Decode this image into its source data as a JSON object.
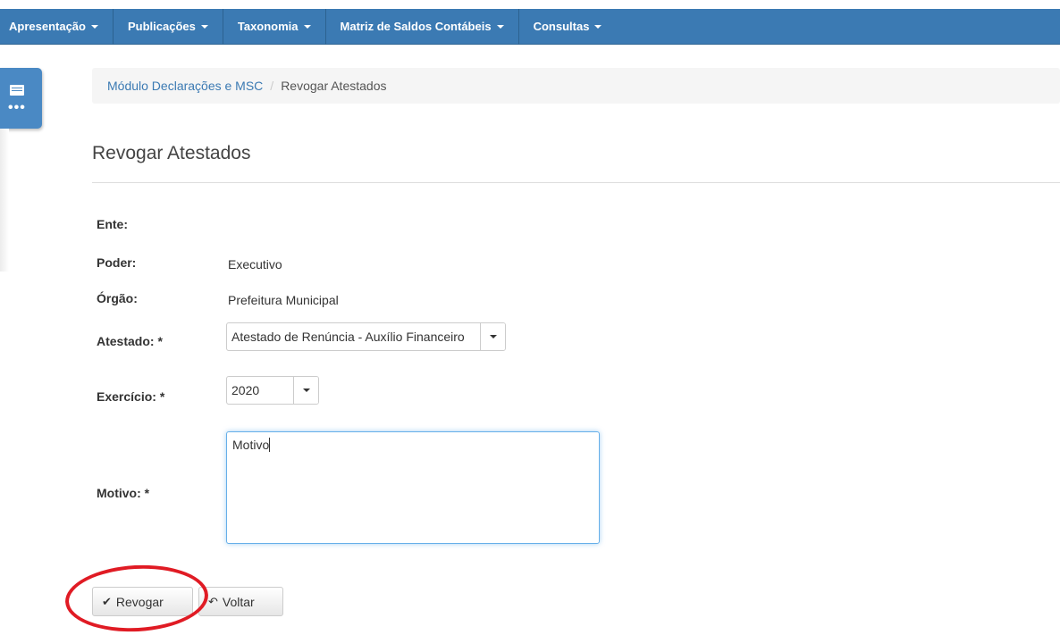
{
  "nav": {
    "items": [
      {
        "label": "Apresentação"
      },
      {
        "label": "Publicações"
      },
      {
        "label": "Taxonomia"
      },
      {
        "label": "Matriz de Saldos Contábeis"
      },
      {
        "label": "Consultas"
      }
    ]
  },
  "side_widget": {
    "icon": "list-icon",
    "dots": "•••"
  },
  "breadcrumb": {
    "parent": "Módulo Declarações e MSC",
    "separator": "/",
    "current": "Revogar Atestados"
  },
  "page": {
    "title": "Revogar Atestados"
  },
  "form": {
    "ente_label": "Ente:",
    "ente_value": "",
    "poder_label": "Poder:",
    "poder_value": "Executivo",
    "orgao_label": "Órgão:",
    "orgao_value": "Prefeitura Municipal",
    "atestado_label": "Atestado: *",
    "atestado_value": "Atestado de Renúncia - Auxílio Financeiro",
    "exercicio_label": "Exercício: *",
    "exercicio_value": "2020",
    "motivo_label": "Motivo: *",
    "motivo_value": "Motivo"
  },
  "buttons": {
    "revogar_label": "Revogar",
    "voltar_label": "Voltar"
  },
  "colors": {
    "nav_bg": "#3b7ab3",
    "link": "#3b7ab3",
    "annotation": "#e01b24"
  }
}
